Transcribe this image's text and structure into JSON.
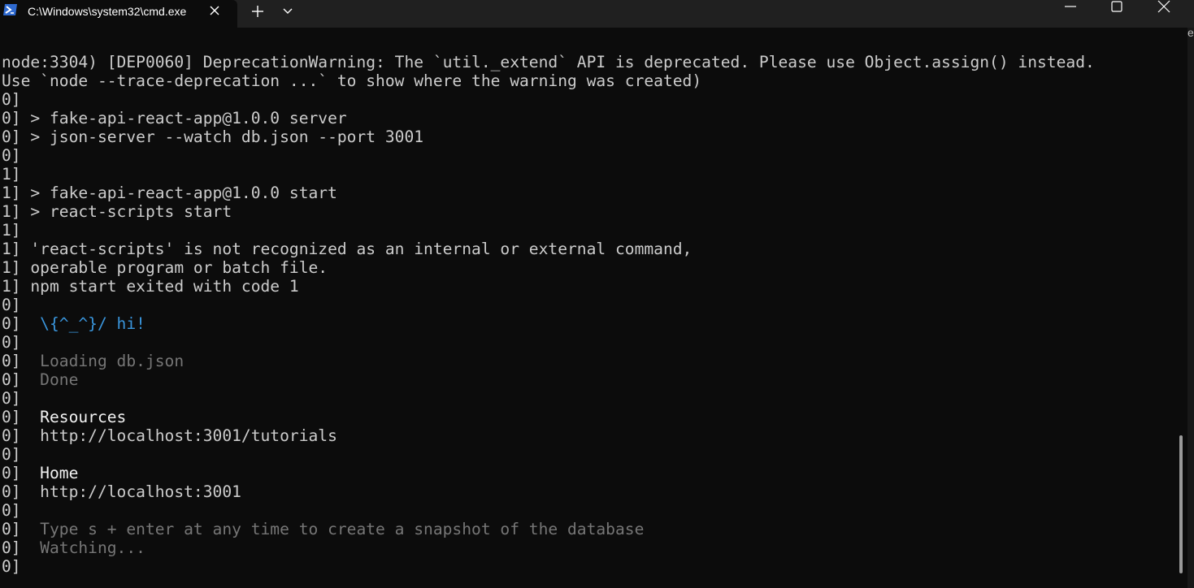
{
  "window": {
    "tab_title": "C:\\Windows\\system32\\cmd.exe",
    "edge_text": "e",
    "icons": {
      "tab_icon": "terminal-prompt-icon",
      "close_tab": "close-icon",
      "new_tab": "plus-icon",
      "dropdown": "chevron-down-icon",
      "minimize": "minimize-icon",
      "maximize": "maximize-icon",
      "close_window": "close-icon"
    }
  },
  "terminal": {
    "lines": [
      "node:3304) [DEP0060] DeprecationWarning: The `util._extend` API is deprecated. Please use Object.assign() instead.",
      "Use `node --trace-deprecation ...` to show where the warning was created)",
      "0]",
      "0] > fake-api-react-app@1.0.0 server",
      "0] > json-server --watch db.json --port 3001",
      "0]",
      "1]",
      "1] > fake-api-react-app@1.0.0 start",
      "1] > react-scripts start",
      "1]",
      "1] 'react-scripts' is not recognized as an internal or external command,",
      "1] operable program or batch file.",
      "1] npm start exited with code 1",
      "0]",
      "0]",
      "0]",
      "0]",
      "0]",
      "0]",
      "0]",
      "0]",
      "0]",
      "0]",
      "0]",
      "0]",
      "0]",
      "0]",
      "0]"
    ],
    "colored_segments": [
      {
        "line": 14,
        "text": "  \\{^_^}/ hi!",
        "color": "#3a96dd"
      },
      {
        "line": 16,
        "text": "  Loading db.json",
        "color": "#767676"
      },
      {
        "line": 17,
        "text": "  Done",
        "color": "#767676"
      },
      {
        "line": 19,
        "text": "  Resources",
        "color": "#f2f2f2"
      },
      {
        "line": 20,
        "text": "  http://localhost:3001/tutorials",
        "color": "#cccccc"
      },
      {
        "line": 22,
        "text": "  Home",
        "color": "#f2f2f2"
      },
      {
        "line": 23,
        "text": "  http://localhost:3001",
        "color": "#cccccc"
      },
      {
        "line": 25,
        "text": "  Type s + enter at any time to create a snapshot of the database",
        "color": "#767676"
      },
      {
        "line": 26,
        "text": "  Watching...",
        "color": "#767676"
      }
    ]
  },
  "colors": {
    "background": "#0c0c0c",
    "titlebar": "#202020",
    "text": "#cccccc",
    "cyan": "#3a96dd",
    "gray": "#767676",
    "bright_white": "#f2f2f2"
  }
}
